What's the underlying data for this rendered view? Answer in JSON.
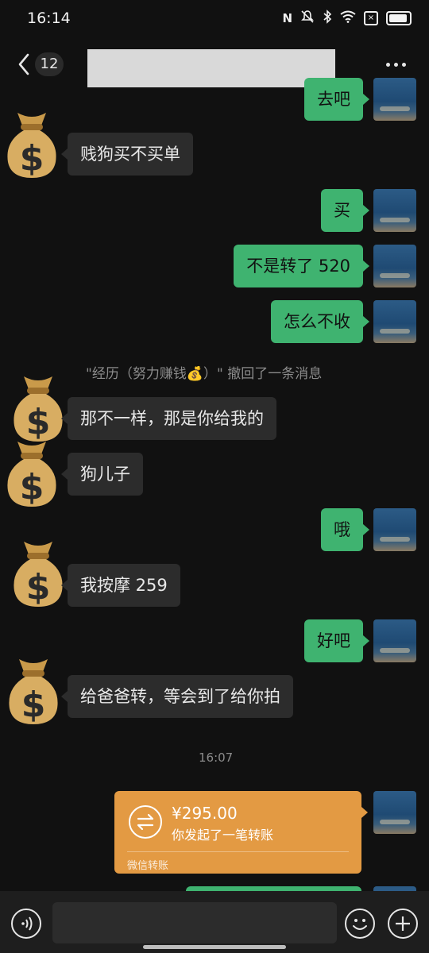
{
  "status_bar": {
    "time": "16:14"
  },
  "nav": {
    "unread_count": "12"
  },
  "messages": [
    {
      "side": "right",
      "text": "去吧"
    },
    {
      "side": "left",
      "text": "贱狗买不买单"
    },
    {
      "side": "right",
      "text": "买"
    },
    {
      "side": "right",
      "text": "不是转了 520"
    },
    {
      "side": "right",
      "text": "怎么不收"
    },
    {
      "side": "left",
      "text": "那不一样，那是你给我的"
    },
    {
      "side": "left",
      "text": "狗儿子"
    },
    {
      "side": "right",
      "text": "哦"
    },
    {
      "side": "left",
      "text": "我按摩 259"
    },
    {
      "side": "right",
      "text": "好吧"
    },
    {
      "side": "left",
      "text": "给爸爸转，等会到了给你拍"
    }
  ],
  "system_notice": {
    "part1": "\"经历（努力赚钱",
    "emoji": "💰",
    "part2": "）\" 撤回了一条消息"
  },
  "timestamp": "16:07",
  "transfer": {
    "amount": "¥295.00",
    "description": "你发起了一笔转账",
    "footer": "微信转账"
  },
  "colors": {
    "bubble_self": "#3fb370",
    "bubble_other": "#2c2c2c",
    "transfer": "#e39a43",
    "background": "#111111"
  },
  "icons": {
    "avatar_other": "money-bag-emoji",
    "voice": "voice-icon",
    "emoji": "smile-icon",
    "plus": "plus-icon"
  }
}
